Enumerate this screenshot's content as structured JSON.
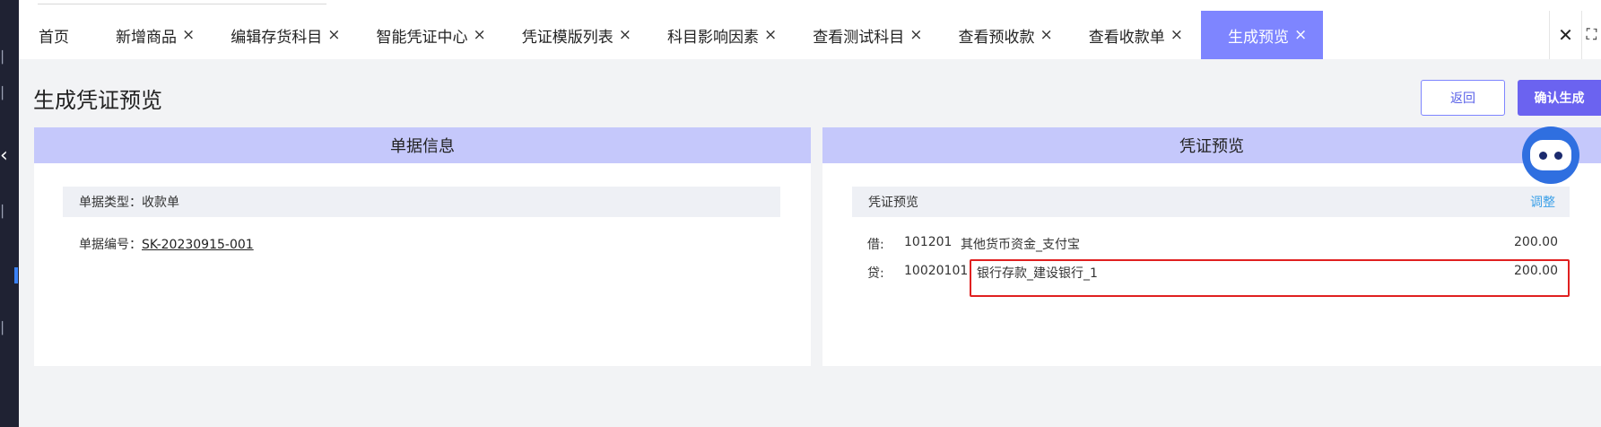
{
  "tabs": [
    {
      "label": "首页",
      "closable": false,
      "active": false
    },
    {
      "label": "新增商品",
      "closable": true,
      "active": false
    },
    {
      "label": "编辑存货科目",
      "closable": true,
      "active": false
    },
    {
      "label": "智能凭证中心",
      "closable": true,
      "active": false
    },
    {
      "label": "凭证模版列表",
      "closable": true,
      "active": false
    },
    {
      "label": "科目影响因素",
      "closable": true,
      "active": false
    },
    {
      "label": "查看测试科目",
      "closable": true,
      "active": false
    },
    {
      "label": "查看预收款",
      "closable": true,
      "active": false
    },
    {
      "label": "查看收款单",
      "closable": true,
      "active": false
    },
    {
      "label": "生成预览",
      "closable": true,
      "active": true
    }
  ],
  "tab_close_symbol": "×",
  "close_all_symbol": "✕",
  "expand_symbol": "⛶",
  "page": {
    "title": "生成凭证预览",
    "back_label": "返回",
    "confirm_label": "确认生成"
  },
  "doc_panel": {
    "header": "单据信息",
    "type_text": "单据类型：收款单",
    "number_label": "单据编号：",
    "number_value": "SK-20230915-001"
  },
  "voucher_panel": {
    "header": "凭证预览",
    "bar_title": "凭证预览",
    "adjust_label": "调整",
    "entries": [
      {
        "dir": "借:",
        "code": "101201",
        "name": "其他货币资金_支付宝",
        "amount": "200.00"
      },
      {
        "dir": "贷:",
        "code": "10020101",
        "name": "银行存款_建设银行_1",
        "amount": "200.00"
      }
    ]
  },
  "colors": {
    "accent": "#7e85ff",
    "confirm": "#6b63f0",
    "panel_header": "#c5c8fb",
    "highlight": "#e02020"
  },
  "icons": {
    "assistant": "robot-assistant-icon"
  }
}
